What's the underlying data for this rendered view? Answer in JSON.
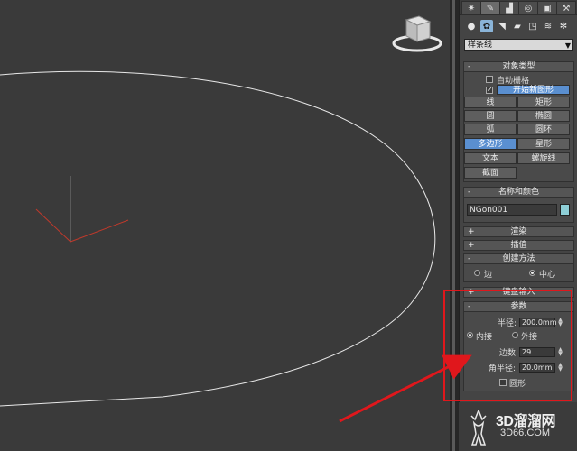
{
  "colors": {
    "viewport_bg": "#3a3a3a",
    "panel_bg": "#444444",
    "active_button": "#5a8fd0",
    "highlight_red": "#e0171c",
    "object_color_swatch": "#8ecfd7"
  },
  "command_tabs": [
    {
      "icon": "sun-icon",
      "glyph": "✷"
    },
    {
      "icon": "create-icon",
      "glyph": "✎"
    },
    {
      "icon": "hierarchy-icon",
      "glyph": "▟"
    },
    {
      "icon": "motion-icon",
      "glyph": "◎"
    },
    {
      "icon": "display-icon",
      "glyph": "▣"
    },
    {
      "icon": "utilities-icon",
      "glyph": "⚒"
    }
  ],
  "category_icons": [
    {
      "icon": "geometry-icon",
      "glyph": "●"
    },
    {
      "icon": "shapes-icon",
      "glyph": "✿"
    },
    {
      "icon": "lights-icon",
      "glyph": "◥"
    },
    {
      "icon": "cameras-icon",
      "glyph": "▰"
    },
    {
      "icon": "helpers-icon",
      "glyph": "◳"
    },
    {
      "icon": "spacewarps-icon",
      "glyph": "≋"
    },
    {
      "icon": "systems-icon",
      "glyph": "✻"
    }
  ],
  "dropdown": {
    "value": "样条线"
  },
  "object_type": {
    "header": "对象类型",
    "autogrid_label": "自动栅格",
    "start_new_shape_label": "开始新图形",
    "buttons": [
      {
        "label": "线"
      },
      {
        "label": "矩形"
      },
      {
        "label": "圆"
      },
      {
        "label": "椭圆"
      },
      {
        "label": "弧"
      },
      {
        "label": "圆环"
      },
      {
        "label": "多边形"
      },
      {
        "label": "星形"
      },
      {
        "label": "文本"
      },
      {
        "label": "螺旋线"
      },
      {
        "label": "截面"
      }
    ]
  },
  "name_color": {
    "header": "名称和颜色",
    "name_value": "NGon001"
  },
  "rollups": {
    "render": "渲染",
    "interpolation": "插值",
    "creation_method": "创建方法",
    "keyboard_entry": "键盘输入",
    "parameters": "参数"
  },
  "creation_method": {
    "edge": "边",
    "center": "中心"
  },
  "parameters": {
    "radius_label": "半径:",
    "radius_value": "200.0mm",
    "inscribed": "内接",
    "circumscribed": "外接",
    "sides_label": "边数:",
    "sides_value": "29",
    "corner_radius_label": "角半径:",
    "corner_radius_value": "20.0mm",
    "circular_label": "圆形"
  },
  "plus": "+",
  "minus": "-",
  "watermark": {
    "main": "3D溜溜网",
    "sub": "3D66.COM"
  }
}
